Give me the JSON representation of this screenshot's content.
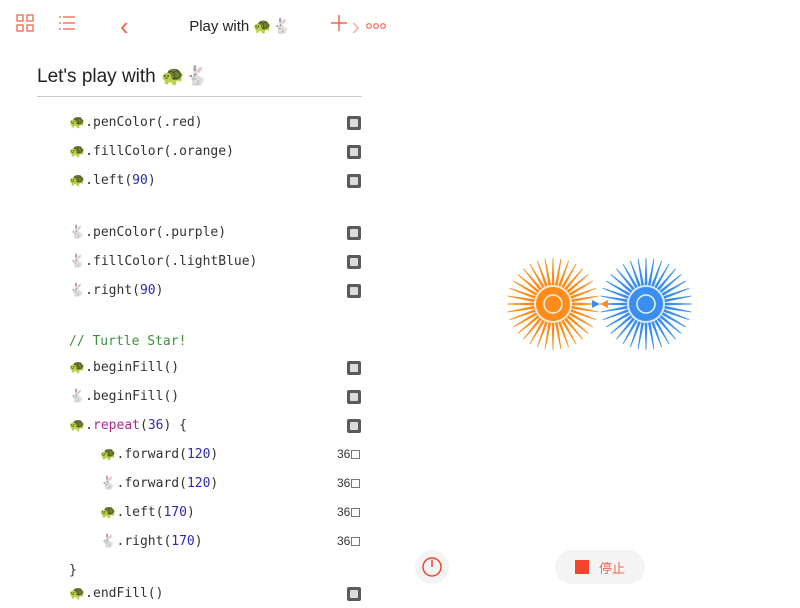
{
  "nav": {
    "title": "Play with 🐢🐇",
    "back": "‹",
    "forward": "›"
  },
  "doc": {
    "heading": "Let's play with 🐢🐇"
  },
  "code": {
    "lines": [
      {
        "t": "🐢.penColor(.red)"
      },
      {
        "t": "🐢.fillColor(.orange)"
      },
      {
        "t": "🐢.left(",
        "n": "90",
        "e": ")"
      },
      {
        "t": "🐇.penColor(.purple)"
      },
      {
        "t": "🐇.fillColor(.lightBlue)"
      },
      {
        "t": "🐇.right(",
        "n": "90",
        "e": ")"
      },
      {
        "c": "// Turtle Star!"
      },
      {
        "t": "🐢.beginFill()"
      },
      {
        "t": "🐇.beginFill()"
      },
      {
        "t": "🐢.",
        "f": "repeat",
        "p": "(",
        "n": "36",
        "e": ") {"
      },
      {
        "t": "    🐢.forward(",
        "n": "120",
        "e": ")",
        "count": "36"
      },
      {
        "t": "    🐇.forward(",
        "n": "120",
        "e": ")",
        "count": "36"
      },
      {
        "t": "    🐢.left(",
        "n": "170",
        "e": ")",
        "count": "36"
      },
      {
        "t": "    🐇.right(",
        "n": "170",
        "e": ")",
        "count": "36"
      },
      {
        "t": "}"
      },
      {
        "t": "🐢.endFill()"
      }
    ]
  },
  "controls": {
    "stop_label": "停止"
  },
  "colors": {
    "accent": "#f2644f",
    "orange_star": "#ff8c1a",
    "blue_star": "#3a8ef0"
  }
}
